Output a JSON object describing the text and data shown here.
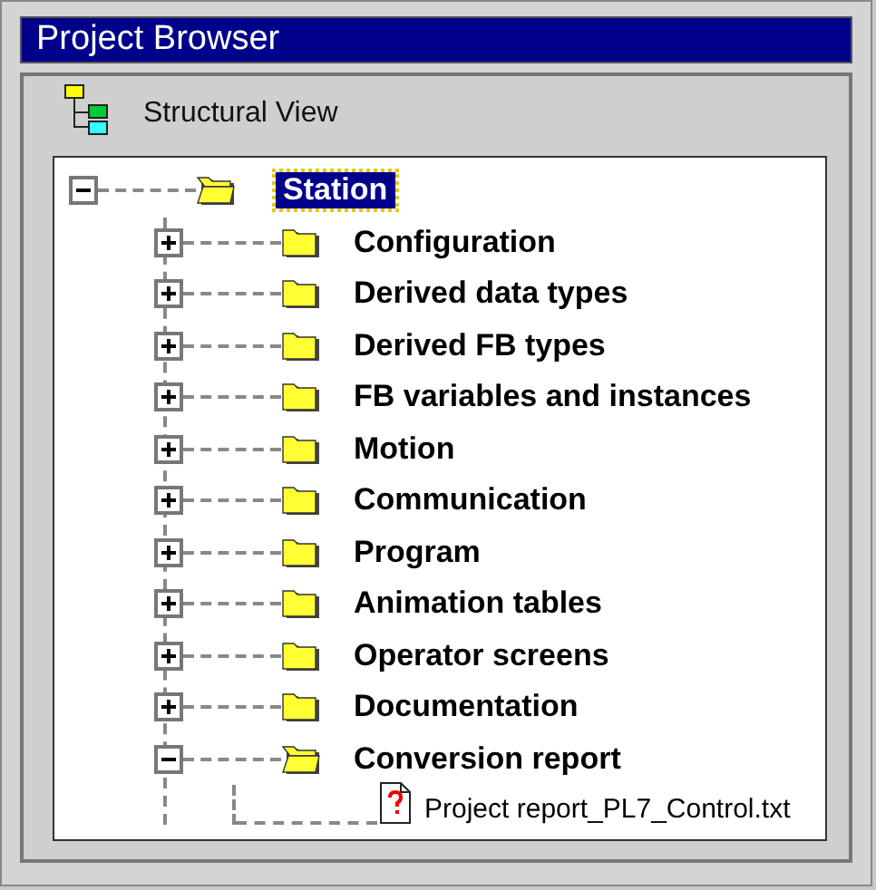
{
  "window": {
    "title": "Project Browser"
  },
  "view": {
    "title": "Structural View"
  },
  "tree": [
    {
      "label": "Station",
      "kind": "folder",
      "expanded": true,
      "selected": true,
      "children": [
        {
          "label": "Configuration",
          "kind": "folder",
          "expanded": false,
          "selected": false
        },
        {
          "label": "Derived data types",
          "kind": "folder",
          "expanded": false,
          "selected": false
        },
        {
          "label": "Derived FB types",
          "kind": "folder",
          "expanded": false,
          "selected": false
        },
        {
          "label": "FB variables and instances",
          "kind": "folder",
          "expanded": false,
          "selected": false
        },
        {
          "label": "Motion",
          "kind": "folder",
          "expanded": false,
          "selected": false
        },
        {
          "label": "Communication",
          "kind": "folder",
          "expanded": false,
          "selected": false
        },
        {
          "label": "Program",
          "kind": "folder",
          "expanded": false,
          "selected": false
        },
        {
          "label": "Animation tables",
          "kind": "folder",
          "expanded": false,
          "selected": false
        },
        {
          "label": "Operator screens",
          "kind": "folder",
          "expanded": false,
          "selected": false
        },
        {
          "label": "Documentation",
          "kind": "folder",
          "expanded": false,
          "selected": false
        },
        {
          "label": "Conversion report",
          "kind": "folder",
          "expanded": true,
          "selected": false,
          "children": [
            {
              "label": "Project report_PL7_Control.txt",
              "kind": "file",
              "selected": false
            }
          ]
        }
      ]
    }
  ]
}
